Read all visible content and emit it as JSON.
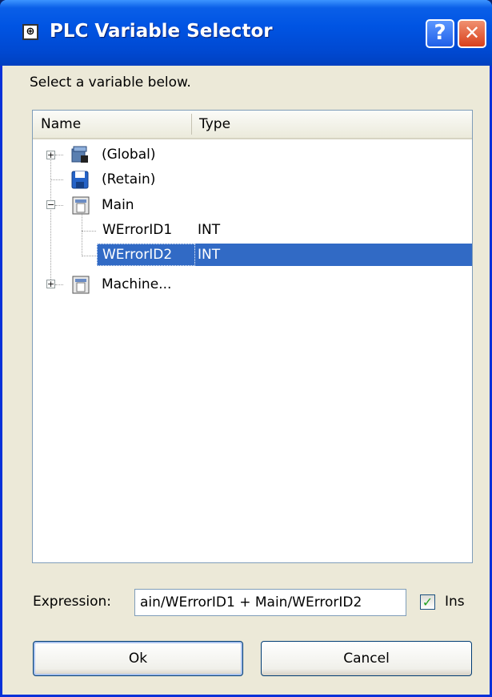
{
  "window": {
    "title": "PLC Variable Selector",
    "help_glyph": "?",
    "close_glyph": "✕"
  },
  "instructions": "Select a variable below.",
  "tree": {
    "columns": {
      "name": "Name",
      "type": "Type"
    },
    "items": [
      {
        "name": "(Global)",
        "type": "",
        "expander": "+"
      },
      {
        "name": "(Retain)",
        "type": "",
        "expander": ""
      },
      {
        "name": "Main",
        "type": "",
        "expander": "−"
      },
      {
        "name": "WErrorID1",
        "type": "INT",
        "expander": ""
      },
      {
        "name": "WErrorID2",
        "type": "INT",
        "expander": "",
        "selected": true
      },
      {
        "name": "Machine...",
        "type": "",
        "expander": "+"
      }
    ]
  },
  "expression": {
    "label": "Expression:",
    "value": "ain/WErrorID1 + Main/WErrorID2"
  },
  "ins": {
    "label": "Ins",
    "checked": true,
    "check_glyph": "✓"
  },
  "buttons": {
    "ok": "Ok",
    "cancel": "Cancel"
  },
  "colors": {
    "selection": "#316ac5",
    "titlebar": "#0054e3"
  }
}
